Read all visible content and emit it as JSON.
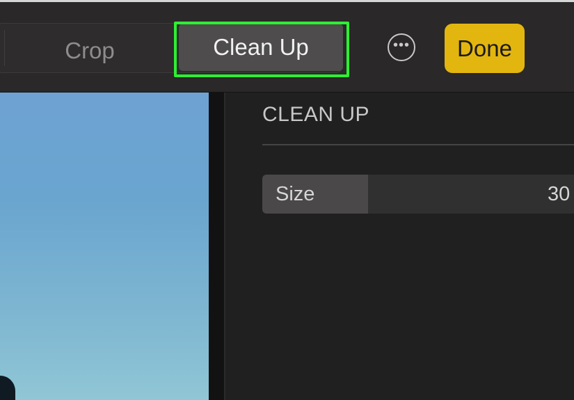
{
  "toolbar": {
    "tabs": [
      {
        "label": "Crop"
      },
      {
        "label": "Clean Up",
        "selected": true
      }
    ],
    "more_icon": "ellipsis-circle-icon",
    "done_label": "Done",
    "highlight_color": "#2df033",
    "done_color": "#e3b50f"
  },
  "panel": {
    "title": "CLEAN UP",
    "size": {
      "label": "Size",
      "value_text": "30",
      "fill_fraction": 0.33
    }
  }
}
